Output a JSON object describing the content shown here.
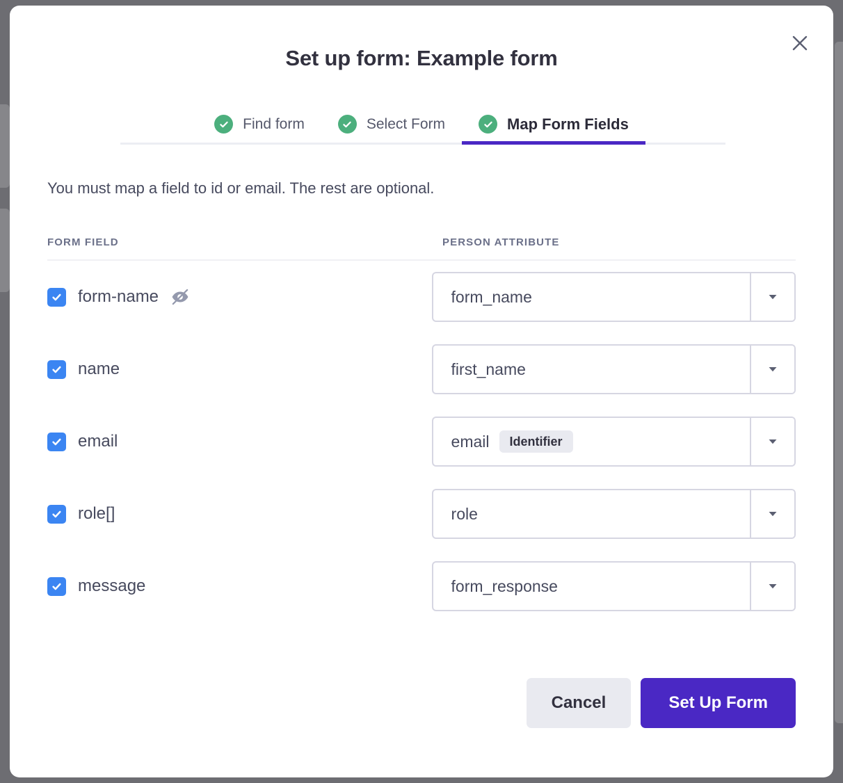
{
  "modal": {
    "title": "Set up form: Example form",
    "close_icon": "close-icon"
  },
  "tabs": [
    {
      "label": "Find form",
      "state": "complete",
      "active": false,
      "icon": "check-circle-icon"
    },
    {
      "label": "Select Form",
      "state": "complete",
      "active": false,
      "icon": "check-circle-icon"
    },
    {
      "label": "Map Form Fields",
      "state": "complete",
      "active": true,
      "icon": "check-circle-icon"
    }
  ],
  "instruction": "You must map a field to id or email. The rest are optional.",
  "columns": {
    "form_field": "FORM FIELD",
    "person_attribute": "PERSON ATTRIBUTE"
  },
  "rows": [
    {
      "field_label": "form-name",
      "checked": true,
      "hidden_icon": "eye-off-icon",
      "attribute": "form_name",
      "badge": null
    },
    {
      "field_label": "name",
      "checked": true,
      "hidden_icon": null,
      "attribute": "first_name",
      "badge": null
    },
    {
      "field_label": "email",
      "checked": true,
      "hidden_icon": null,
      "attribute": "email",
      "badge": "Identifier"
    },
    {
      "field_label": "role[]",
      "checked": true,
      "hidden_icon": null,
      "attribute": "role",
      "badge": null
    },
    {
      "field_label": "message",
      "checked": true,
      "hidden_icon": null,
      "attribute": "form_response",
      "badge": null
    }
  ],
  "footer": {
    "cancel_label": "Cancel",
    "submit_label": "Set Up Form"
  },
  "colors": {
    "accent_purple": "#4a28c4",
    "checkbox_blue": "#3b85f2",
    "complete_green": "#4caf7d",
    "text_dark": "#32313f",
    "text_body": "#474a5e",
    "border": "#d6d6e2",
    "badge_bg": "#e9eaf0",
    "backdrop": "#6d6d72"
  }
}
